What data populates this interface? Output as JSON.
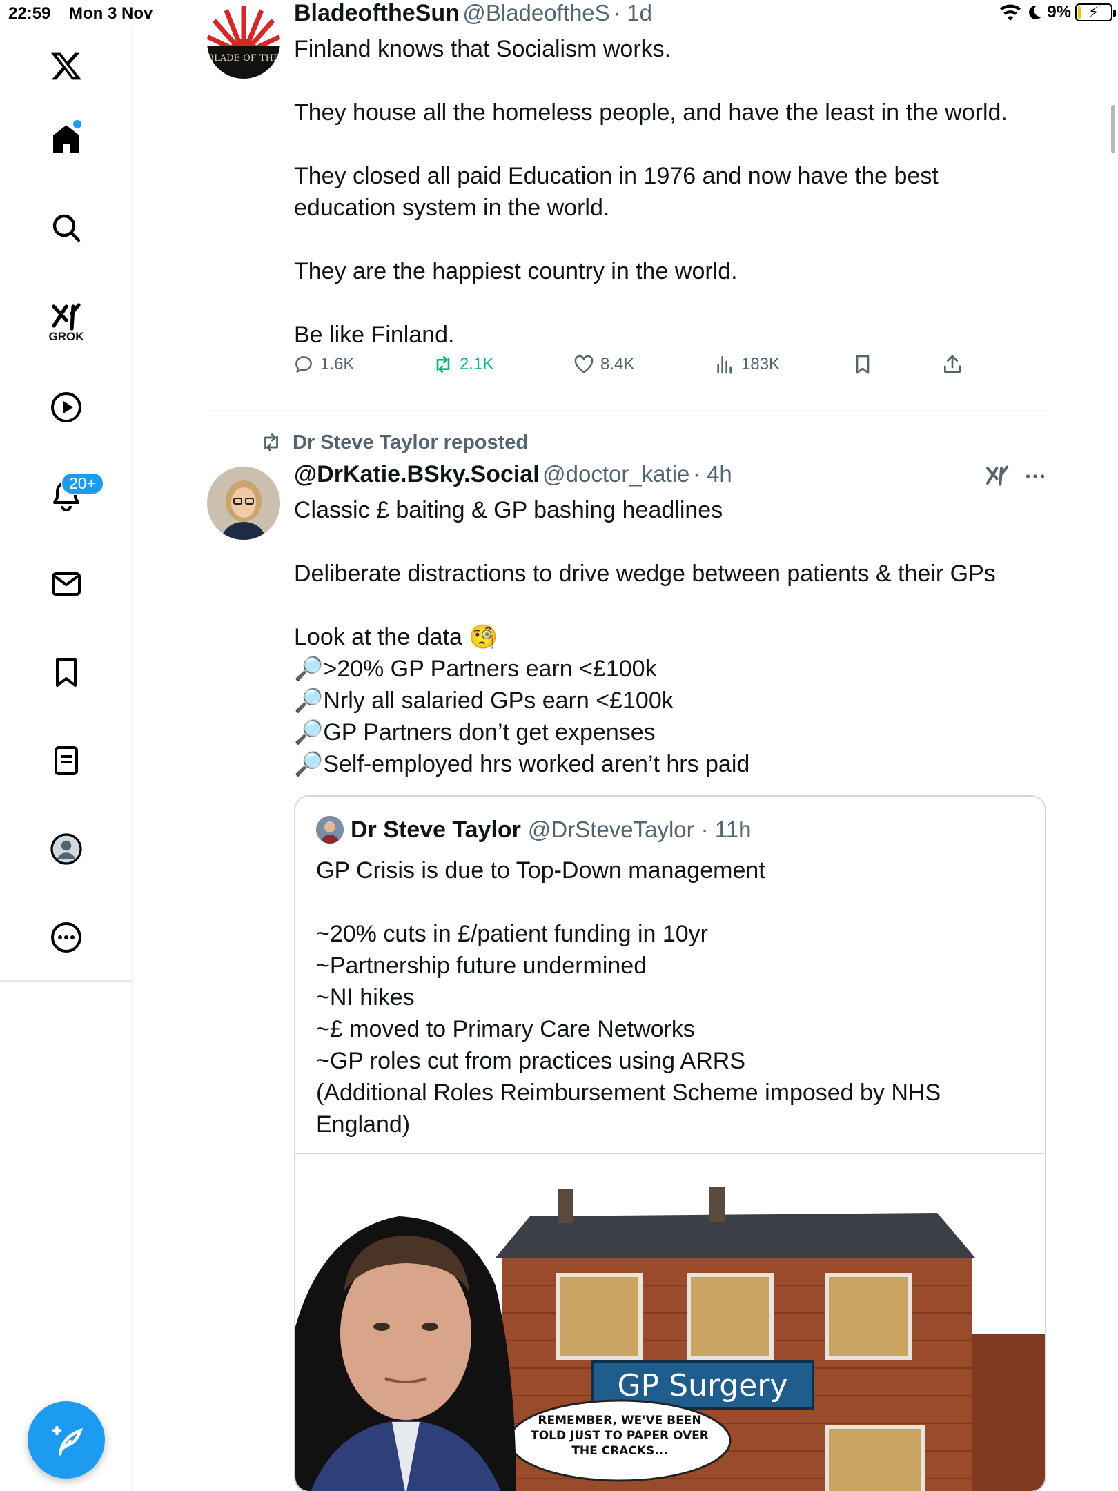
{
  "status_bar": {
    "time": "22:59",
    "date": "Mon 3 Nov",
    "battery": "9%",
    "battery_level": 0.09
  },
  "nav": {
    "grok_label": "GROK",
    "notifications_badge": "20+"
  },
  "tweet1": {
    "name": "BladeoftheSun",
    "handle": "@BladeoftheS",
    "time": "· 1d",
    "avatar_text": "BLADE OF THE",
    "text": "Finland knows that Socialism works.\n\nThey house all the homeless people, and have the least in the world.\n\nThey closed all paid Education in 1976 and now have the best education system in the world.\n\nThey are the happiest country in the world.\n\nBe like Finland.",
    "replies": "1.6K",
    "reposts": "2.1K",
    "likes": "8.4K",
    "views": "183K"
  },
  "tweet2": {
    "repost_label": "Dr Steve Taylor reposted",
    "name": "@DrKatie.BSky.Social",
    "handle": "@doctor_katie",
    "time": "· 4h",
    "text": "Classic £ baiting & GP bashing headlines\n\nDeliberate distractions to drive wedge between patients & their GPs\n\nLook at the data 🧐\n🔎>20% GP Partners earn <£100k\n🔎Nrly all salaried GPs earn <£100k\n🔎GP Partners don’t get expenses\n🔎Self-employed hrs worked aren’t hrs paid",
    "quote": {
      "name": "Dr Steve Taylor",
      "handle": "@DrSteveTaylor",
      "time": "· 11h",
      "text": "GP Crisis is due to Top-Down management\n\n~20% cuts in £/patient funding in 10yr\n~Partnership future undermined\n~NI hikes\n~£ moved to Primary Care Networks\n~GP roles cut from practices using ARRS\n (Additional Roles Reimbursement Scheme imposed by NHS England)",
      "image": {
        "sign_text": "GP Surgery",
        "speech_bubble": "REMEMBER, WE'VE BEEN TOLD JUST TO PAPER OVER THE CRACKS..."
      }
    }
  },
  "colors": {
    "accent": "#1d9bf0",
    "repost_green": "#00ba7c",
    "text": "#0f1419",
    "muted": "#536471"
  }
}
